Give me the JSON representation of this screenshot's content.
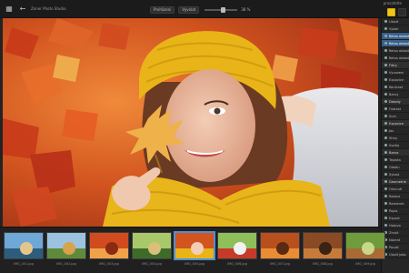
{
  "topbar": {
    "file_label": "Zoner Photo Studio",
    "mode_left": "Prohlizeni",
    "mode_right": "Vyvolat",
    "zoom": "38 %",
    "brand": "prosatelte"
  },
  "filmstrip": {
    "thumbs": [
      {
        "label": "IMG_001.jpg",
        "theme": "sea"
      },
      {
        "label": "IMG_002.jpg",
        "theme": "trees"
      },
      {
        "label": "IMG_003.jpg",
        "theme": "leaves"
      },
      {
        "label": "IMG_004.jpg",
        "theme": "forest"
      },
      {
        "label": "IMG_005.jpg",
        "theme": "portrait",
        "active": true
      },
      {
        "label": "IMG_006.jpg",
        "theme": "mushroom"
      },
      {
        "label": "IMG_007.jpg",
        "theme": "autumn"
      },
      {
        "label": "IMG_008.jpg",
        "theme": "chestnut"
      },
      {
        "label": "IMG_009.jpg",
        "theme": "deer"
      }
    ]
  },
  "panel": {
    "items": [
      {
        "label": "Ulozit",
        "type": "row"
      },
      {
        "label": "Vyber",
        "type": "row"
      },
      {
        "label": "Retus oblast",
        "type": "sel"
      },
      {
        "label": "Retus oblast",
        "type": "sel"
      },
      {
        "label": "Retus oblast",
        "type": "row"
      },
      {
        "label": "Retus oblast",
        "type": "row"
      },
      {
        "label": "Filtry",
        "type": "hdr"
      },
      {
        "label": "Vyvazeni",
        "type": "row"
      },
      {
        "label": "Expozice",
        "type": "row"
      },
      {
        "label": "Kontrast",
        "type": "row"
      },
      {
        "label": "Barvy",
        "type": "row"
      },
      {
        "label": "Detaily",
        "type": "hdr"
      },
      {
        "label": "Ostrost",
        "type": "row"
      },
      {
        "label": "Sum",
        "type": "row"
      },
      {
        "label": "Expozice",
        "type": "hdr"
      },
      {
        "label": "Jas",
        "type": "row"
      },
      {
        "label": "Stiny",
        "type": "row"
      },
      {
        "label": "Svetla",
        "type": "row"
      },
      {
        "label": "Barva",
        "type": "hdr"
      },
      {
        "label": "Teplota",
        "type": "row"
      },
      {
        "label": "Odstin",
        "type": "row"
      },
      {
        "label": "Sytost",
        "type": "row"
      },
      {
        "label": "Geometrie",
        "type": "hdr"
      },
      {
        "label": "Oriznuti",
        "type": "row"
      },
      {
        "label": "Rotace",
        "type": "row"
      },
      {
        "label": "Ramecek",
        "type": "row"
      },
      {
        "label": "Popis",
        "type": "row"
      },
      {
        "label": "Export",
        "type": "row"
      },
      {
        "label": "Hotovo",
        "type": "row"
      },
      {
        "label": "Zrusit",
        "type": "row"
      },
      {
        "label": "Navrat",
        "type": "row"
      },
      {
        "label": "Pouzit",
        "type": "row"
      },
      {
        "label": "Ulozit jako",
        "type": "row"
      }
    ]
  },
  "colors": {
    "accent": "#4f8fd8",
    "brand_yellow": "#f0c419",
    "panel_select": "#3a5f8a"
  }
}
